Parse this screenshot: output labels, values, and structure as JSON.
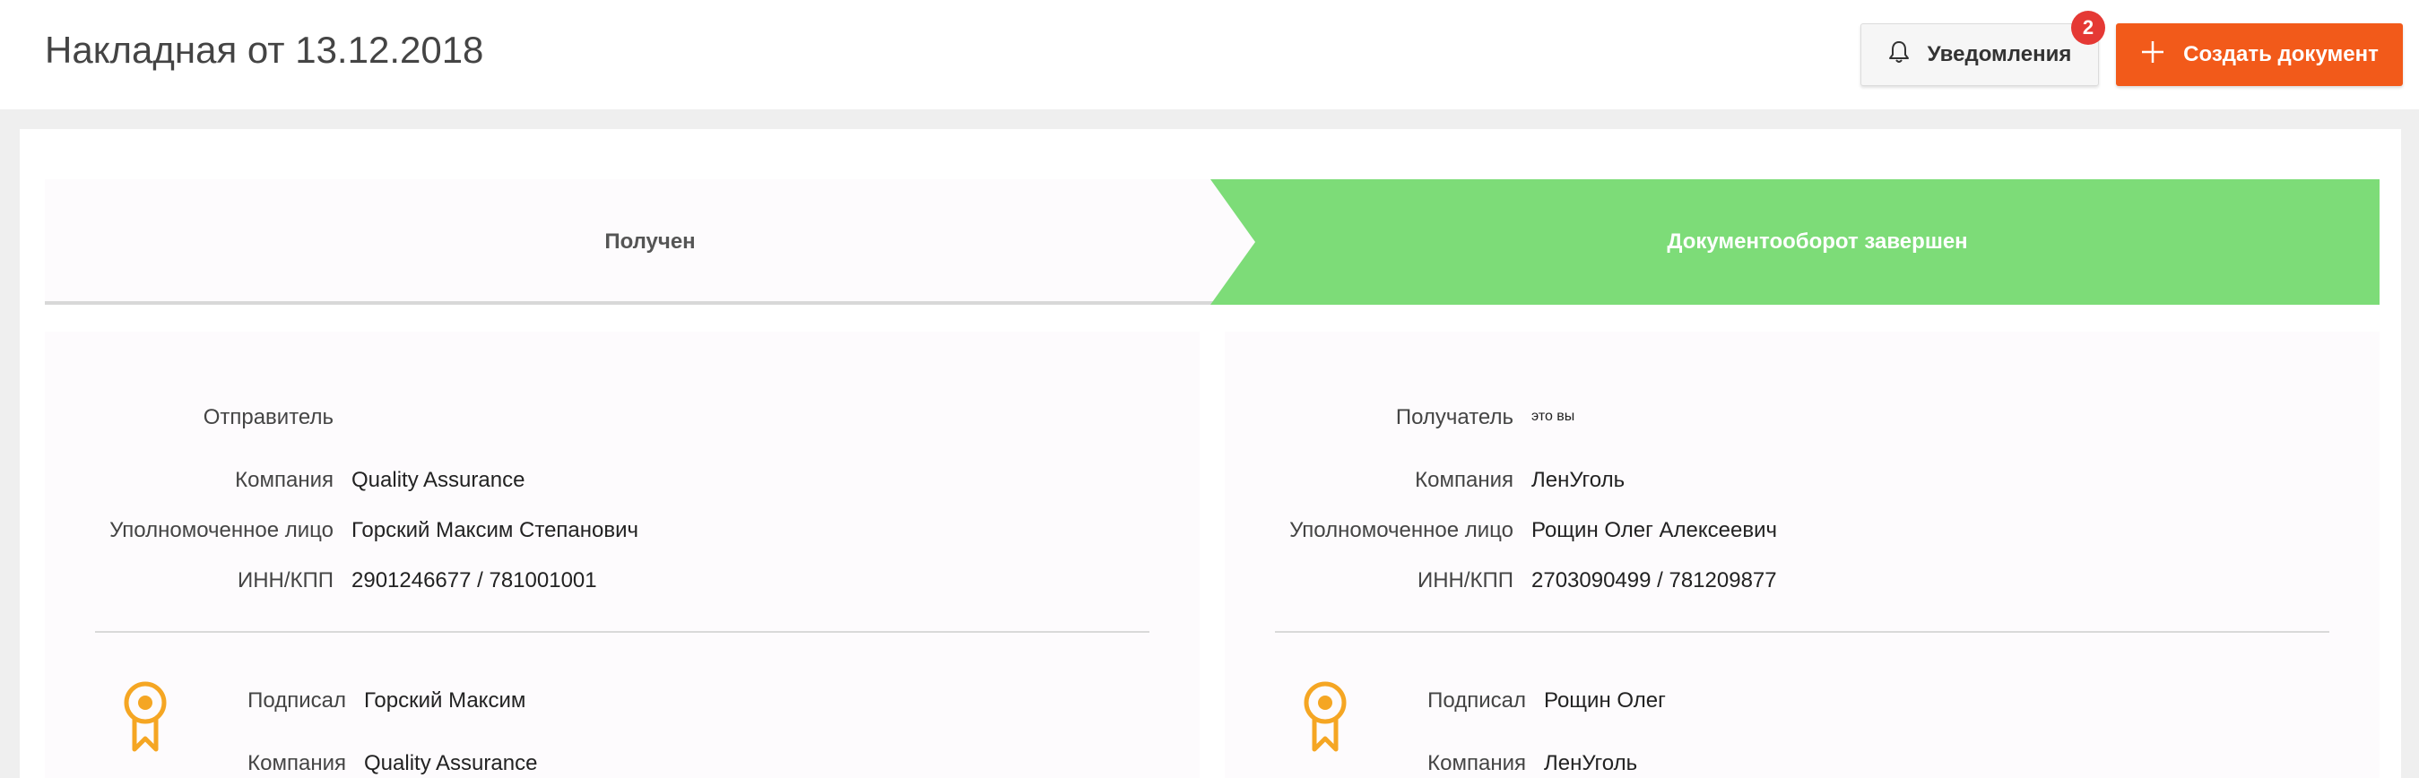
{
  "header": {
    "title": "Накладная от 13.12.2018",
    "notifications_label": "Уведомления",
    "notifications_count": "2",
    "create_label": "Создать документ"
  },
  "progress": {
    "steps": [
      {
        "label": "Получен",
        "state": "done"
      },
      {
        "label": "Документооборот завершен",
        "state": "active"
      }
    ],
    "active_color": "#7ddc78"
  },
  "sender": {
    "title": "Отправитель",
    "note": "",
    "company_label": "Компания",
    "company": "Quality Assurance",
    "person_label": "Уполномоченное лицо",
    "person": "Горский Максим Степанович",
    "inn_label": "ИНН/КПП",
    "inn": "2901246677 / 781001001",
    "signed_label": "Подписал",
    "signed_by": "Горский Максим",
    "sig_company_label": "Компания",
    "sig_company": "Quality Assurance"
  },
  "receiver": {
    "title": "Получатель",
    "note": "это вы",
    "company_label": "Компания",
    "company": "ЛенУголь",
    "person_label": "Уполномоченное лицо",
    "person": "Рощин Олег Алексеевич",
    "inn_label": "ИНН/КПП",
    "inn": "2703090499 / 781209877",
    "signed_label": "Подписал",
    "signed_by": "Рощин Олег",
    "sig_company_label": "Компания",
    "sig_company": "ЛенУголь"
  },
  "colors": {
    "accent": "#f25a1a",
    "badge": "#e53935",
    "medal": "#f5a623"
  },
  "icons": {
    "notifications": "bell-icon",
    "create": "plus-icon",
    "signature": "award-medal-icon"
  }
}
